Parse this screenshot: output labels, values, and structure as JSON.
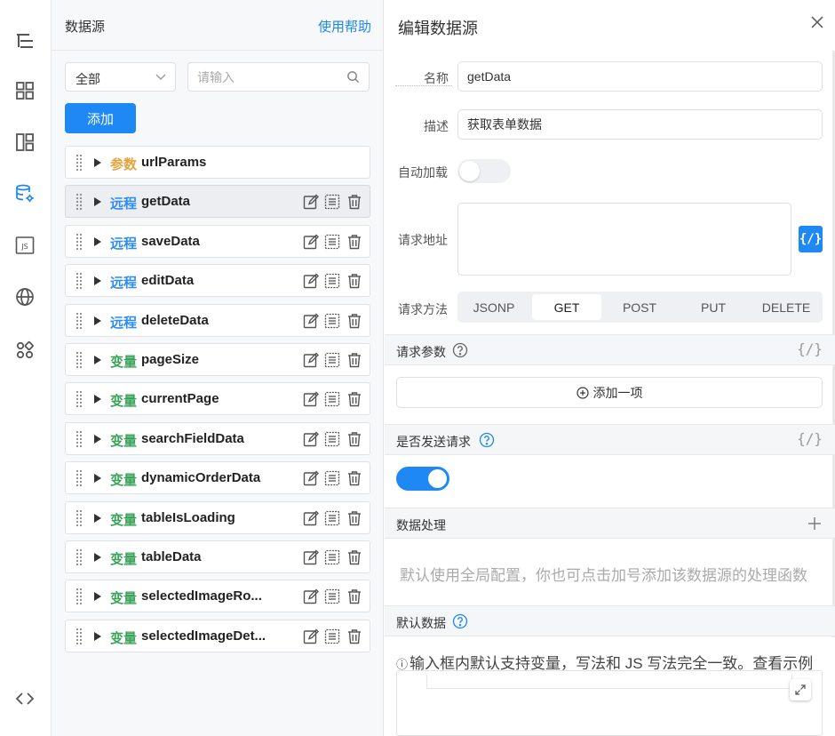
{
  "rail": {
    "icons": [
      "outline-icon",
      "components-icon",
      "layout-icon",
      "datasource-icon",
      "js-icon",
      "globe-icon",
      "apps-icon",
      "code-icon"
    ],
    "js_label": "JS",
    "accent": "#1e88e5"
  },
  "list": {
    "title": "数据源",
    "help": "使用帮助",
    "filter_value": "全部",
    "search_placeholder": "请输入",
    "add_label": "添加",
    "items": [
      {
        "kind": "参数",
        "type": "param",
        "name": "urlParams",
        "has_actions": false,
        "selected": false
      },
      {
        "kind": "远程",
        "type": "remote",
        "name": "getData",
        "has_actions": true,
        "selected": true
      },
      {
        "kind": "远程",
        "type": "remote",
        "name": "saveData",
        "has_actions": true,
        "selected": false
      },
      {
        "kind": "远程",
        "type": "remote",
        "name": "editData",
        "has_actions": true,
        "selected": false
      },
      {
        "kind": "远程",
        "type": "remote",
        "name": "deleteData",
        "has_actions": true,
        "selected": false
      },
      {
        "kind": "变量",
        "type": "var",
        "name": "pageSize",
        "has_actions": true,
        "selected": false
      },
      {
        "kind": "变量",
        "type": "var",
        "name": "currentPage",
        "has_actions": true,
        "selected": false
      },
      {
        "kind": "变量",
        "type": "var",
        "name": "searchFieldData",
        "has_actions": true,
        "selected": false
      },
      {
        "kind": "变量",
        "type": "var",
        "name": "dynamicOrderData",
        "has_actions": true,
        "selected": false
      },
      {
        "kind": "变量",
        "type": "var",
        "name": "tableIsLoading",
        "has_actions": true,
        "selected": false
      },
      {
        "kind": "变量",
        "type": "var",
        "name": "tableData",
        "has_actions": true,
        "selected": false
      },
      {
        "kind": "变量",
        "type": "var",
        "name": "selectedImageRo...",
        "has_actions": true,
        "selected": false
      },
      {
        "kind": "变量",
        "type": "var",
        "name": "selectedImageDet...",
        "has_actions": true,
        "selected": false
      }
    ]
  },
  "editor": {
    "title": "编辑数据源",
    "name_label": "名称",
    "name_value": "getData",
    "desc_label": "描述",
    "desc_value": "获取表单数据",
    "autoload_label": "自动加载",
    "autoload_on": false,
    "url_label": "请求地址",
    "url_value": "",
    "expr_label": "{/}",
    "method_label": "请求方法",
    "methods": [
      "JSONP",
      "GET",
      "POST",
      "PUT",
      "DELETE"
    ],
    "method_selected": "GET",
    "params_label": "请求参数",
    "add_item_label": "添加一项",
    "send_label": "是否发送请求",
    "send_on": true,
    "process_label": "数据处理",
    "process_placeholder": "默认使用全局配置，你也可点击加号添加该数据源的处理函数",
    "default_label": "默认数据",
    "info_text": "输入框内默认支持变量，写法和 JS 写法完全一致。",
    "example_link": "查看示例"
  }
}
